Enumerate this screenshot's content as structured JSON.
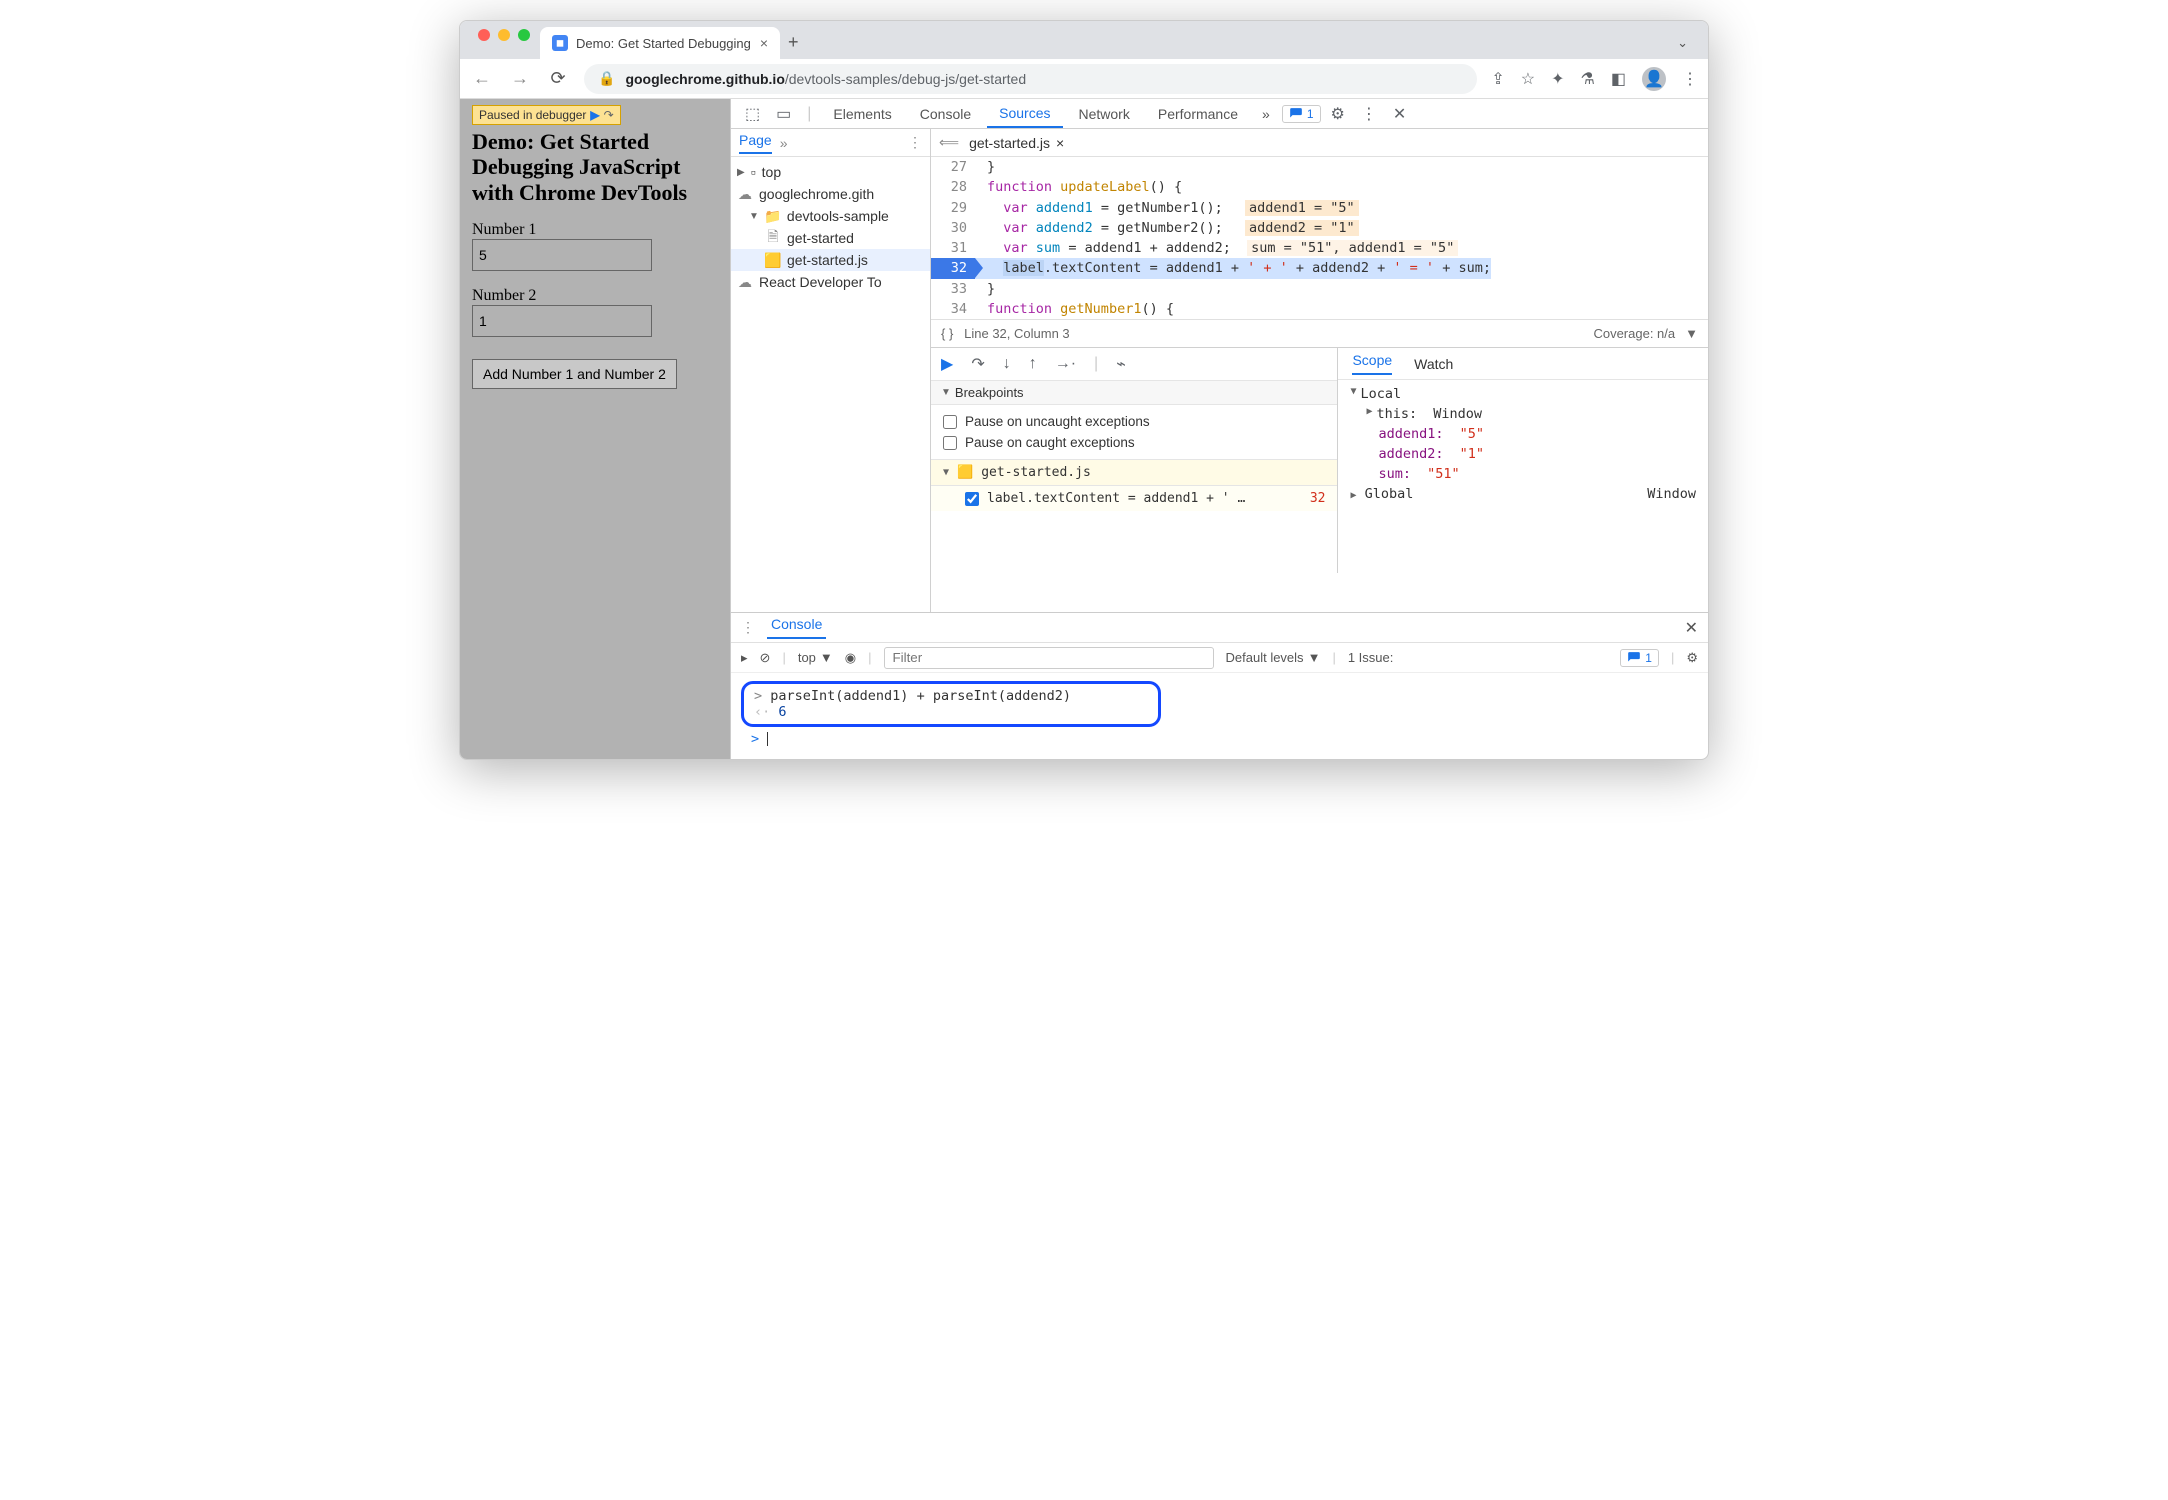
{
  "browser": {
    "tab_title": "Demo: Get Started Debugging",
    "url_host": "googlechrome.github.io",
    "url_path": "/devtools-samples/debug-js/get-started"
  },
  "page": {
    "paused_label": "Paused in debugger",
    "title": "Demo: Get Started Debugging JavaScript with Chrome DevTools",
    "num1_label": "Number 1",
    "num1_value": "5",
    "num2_label": "Number 2",
    "num2_value": "1",
    "add_btn": "Add Number 1 and Number 2"
  },
  "devtools": {
    "tabs": [
      "Elements",
      "Console",
      "Sources",
      "Network",
      "Performance"
    ],
    "active_tab": "Sources",
    "issues_count": "1",
    "nav": {
      "tab": "Page",
      "tree": {
        "top": "top",
        "domain": "googlechrome.gith",
        "folder": "devtools-sample",
        "file_html": "get-started",
        "file_js": "get-started.js",
        "ext": "React Developer To"
      }
    },
    "editor": {
      "filename": "get-started.js",
      "lines": [
        {
          "n": 27,
          "txt": "}"
        },
        {
          "n": 28,
          "txt": "function updateLabel() {",
          "kw": "function",
          "fnname": "updateLabel"
        },
        {
          "n": 29,
          "txt": "  var addend1 = getNumber1();",
          "hint": "addend1 = \"5\""
        },
        {
          "n": 30,
          "txt": "  var addend2 = getNumber2();",
          "hint": "addend2 = \"1\""
        },
        {
          "n": 31,
          "txt": "  var sum = addend1 + addend2;",
          "hint": "sum = \"51\", addend1 = \"5\""
        },
        {
          "n": 32,
          "exec": true,
          "txt": "  label.textContent = addend1 + ' + ' + addend2 + ' = ' + sum;"
        },
        {
          "n": 33,
          "txt": "}"
        },
        {
          "n": 34,
          "txt": "function getNumber1() {"
        }
      ],
      "status_pos": "Line 32, Column 3",
      "coverage": "Coverage: n/a"
    },
    "breakpoints": {
      "header": "Breakpoints",
      "uncaught": "Pause on uncaught exceptions",
      "caught": "Pause on caught exceptions",
      "file": "get-started.js",
      "line_no": "32",
      "line_txt": "label.textContent = addend1 + ' …"
    },
    "scope": {
      "tabs": [
        "Scope",
        "Watch"
      ],
      "local": "Local",
      "this_lbl": "this:",
      "this_val": "Window",
      "a1_k": "addend1:",
      "a1_v": "\"5\"",
      "a2_k": "addend2:",
      "a2_v": "\"1\"",
      "sum_k": "sum:",
      "sum_v": "\"51\"",
      "global": "Global",
      "global_v": "Window"
    }
  },
  "console": {
    "tab": "Console",
    "context": "top",
    "filter_placeholder": "Filter",
    "levels": "Default levels",
    "issue_lbl": "1 Issue:",
    "issue_ct": "1",
    "input": "parseInt(addend1) + parseInt(addend2)",
    "output": "6"
  }
}
